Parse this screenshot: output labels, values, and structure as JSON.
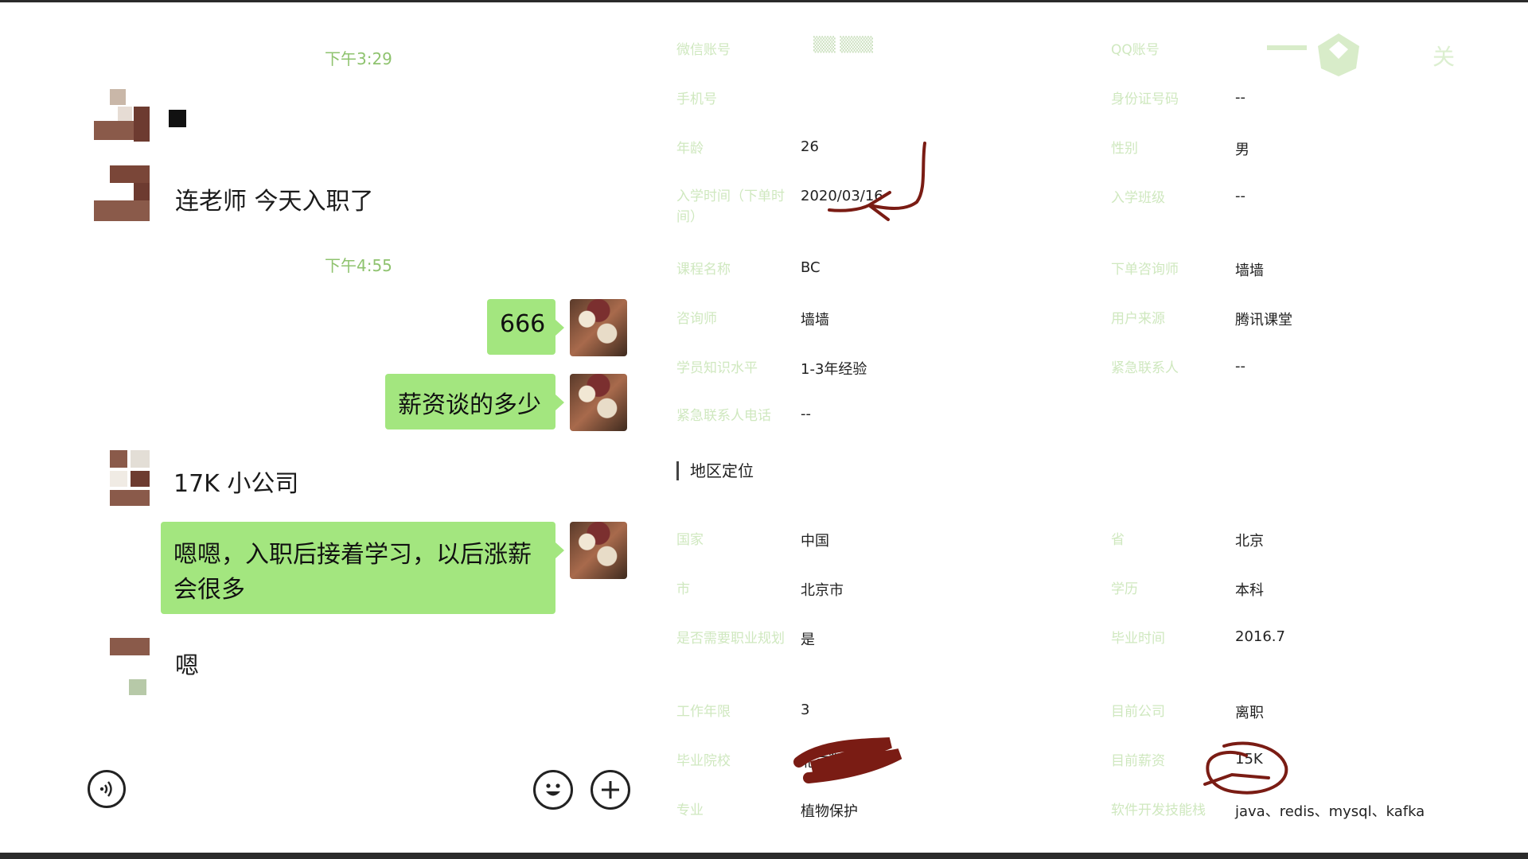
{
  "chat": {
    "messages": [
      {
        "type": "time",
        "text": "下午3:29"
      },
      {
        "type": "in",
        "text": "连老师 今天入职了"
      },
      {
        "type": "time",
        "text": "下午4:55"
      },
      {
        "type": "out",
        "text": "666"
      },
      {
        "type": "out",
        "text": "薪资谈的多少"
      },
      {
        "type": "in",
        "text": "17K  小公司"
      },
      {
        "type": "out",
        "text": "嗯嗯，入职后接着学习，以后涨薪会很多"
      },
      {
        "type": "in",
        "text": "嗯"
      }
    ],
    "bottom_bar": {
      "voice_icon": "voice-icon",
      "emoji_icon": "emoji-icon",
      "add_icon": "plus-icon"
    }
  },
  "profile": {
    "top_left_value_masked": "▒▒   ▒▒▒",
    "fields_left": [
      {
        "label": "微信账号",
        "value": ""
      },
      {
        "label": "手机号",
        "value": ""
      },
      {
        "label": "年龄",
        "value": "26"
      },
      {
        "label": "入学时间（下单时间）",
        "value": "2020/03/16"
      },
      {
        "label": "课程名称",
        "value": "BC"
      },
      {
        "label": "咨询师",
        "value": "墙墙"
      },
      {
        "label": "学员知识水平",
        "value": "1-3年经验"
      },
      {
        "label": "紧急联系人电话",
        "value": "--"
      }
    ],
    "fields_right": [
      {
        "label": "QQ账号",
        "value": ""
      },
      {
        "label": "身份证号码",
        "value": "--"
      },
      {
        "label": "性别",
        "value": "男"
      },
      {
        "label": "入学班级",
        "value": "--"
      },
      {
        "label": "下单咨询师",
        "value": "墙墙"
      },
      {
        "label": "用户来源",
        "value": "腾讯课堂"
      },
      {
        "label": "紧急联系人",
        "value": "--"
      }
    ],
    "section_title": "地区定位",
    "region_left": [
      {
        "label": "国家",
        "value": "中国"
      },
      {
        "label": "市",
        "value": "北京市"
      },
      {
        "label": "是否需要职业规划",
        "value": "是"
      },
      {
        "label": "工作年限",
        "value": "3"
      },
      {
        "label": "毕业院校",
        "value": "北京▒▒学"
      },
      {
        "label": "专业",
        "value": "植物保护"
      }
    ],
    "region_right": [
      {
        "label": "省",
        "value": "北京"
      },
      {
        "label": "学历",
        "value": "本科"
      },
      {
        "label": "毕业时间",
        "value": "2016.7"
      },
      {
        "label": "目前公司",
        "value": "离职"
      },
      {
        "label": "目前薪资",
        "value": "15K"
      },
      {
        "label": "软件开发技能栈",
        "value": "java、redis、mysql、kafka"
      }
    ],
    "top_right_icon": "shield-badge-icon",
    "top_right_text": "关"
  },
  "colors": {
    "bubble_green": "#a3e67f",
    "timestamp_green": "#8fc36f",
    "label_green": "#cfe8bf",
    "ink_red": "#7a1c14"
  }
}
